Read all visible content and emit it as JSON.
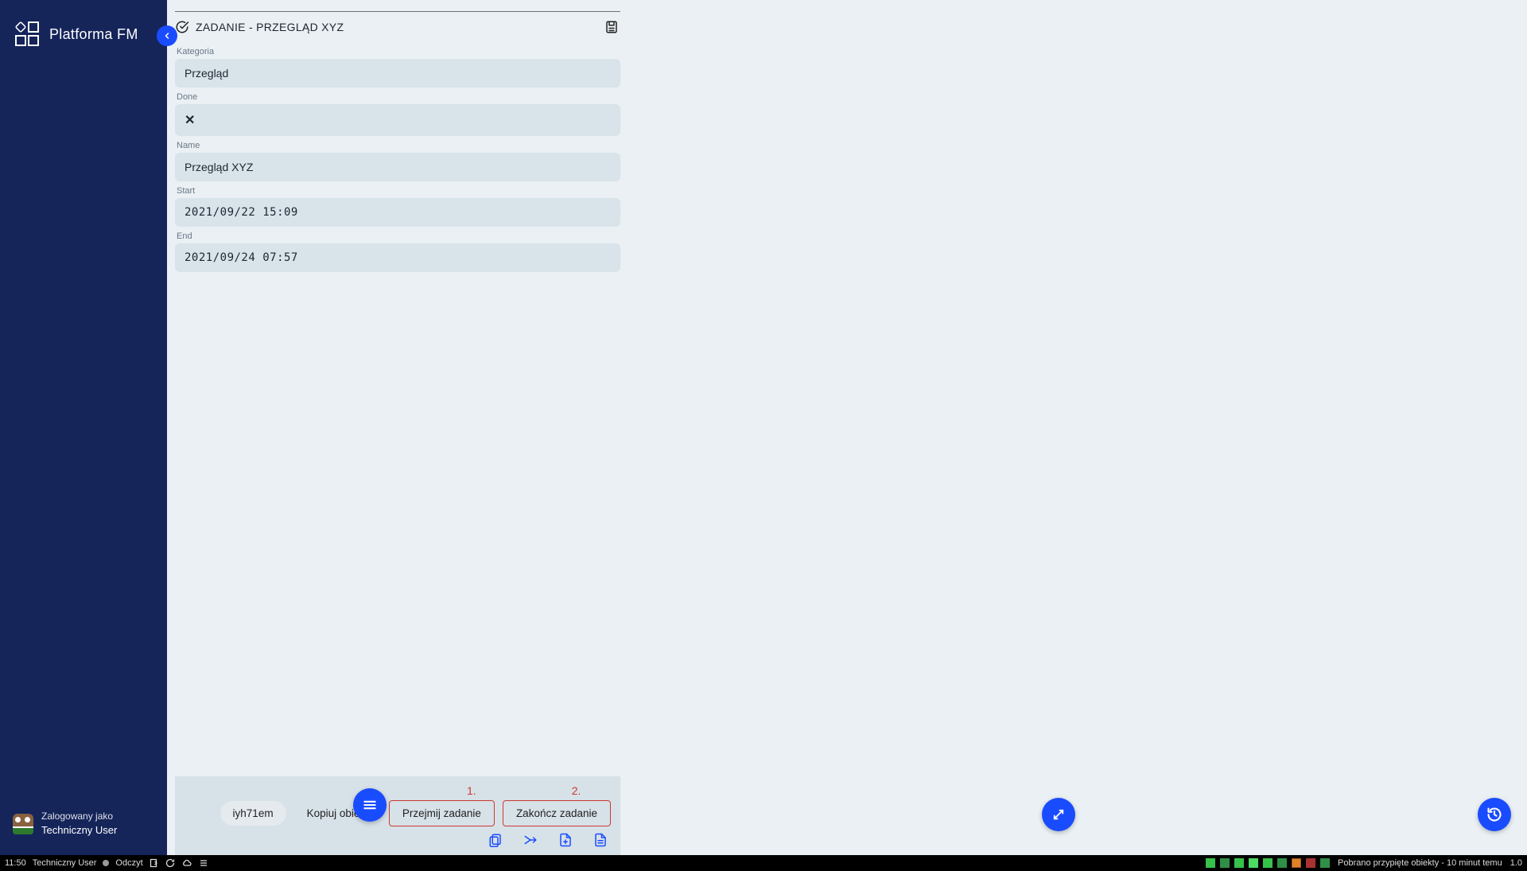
{
  "sidebar": {
    "brand": "Platforma FM",
    "logged_as_label": "Zalogowany jako",
    "username": "Techniczny User"
  },
  "header": {
    "title": "ZADANIE - PRZEGLĄD XYZ"
  },
  "fields": {
    "kategoria": {
      "label": "Kategoria",
      "value": "Przegląd"
    },
    "done": {
      "label": "Done",
      "value": "✕"
    },
    "name": {
      "label": "Name",
      "value": "Przegląd XYZ"
    },
    "start": {
      "label": "Start",
      "value": "2021/09/22 15:09"
    },
    "end": {
      "label": "End",
      "value": "2021/09/24 07:57"
    }
  },
  "annotations": {
    "n1": "1.",
    "n2": "2."
  },
  "footer": {
    "code": "iyh71em",
    "copy_label": "Kopiuj obiekt",
    "take_label": "Przejmij zadanie",
    "finish_label": "Zakończ zadanie",
    "icons": {
      "clipboard": "clipboard-icon",
      "merge": "merge-icon",
      "file_plus": "file-plus-icon",
      "file_text": "file-text-icon"
    }
  },
  "statusbar": {
    "time": "11:50",
    "user": "Techniczny User",
    "mode": "Odczyt",
    "message": "Pobrano przypięte obiekty - 10 minut temu",
    "version": "1.0"
  }
}
